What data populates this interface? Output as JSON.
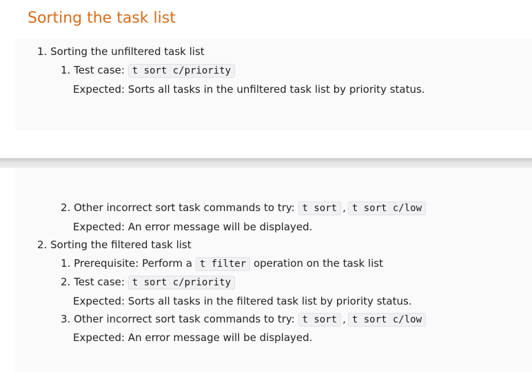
{
  "page": {
    "heading": "Sorting the task list",
    "section1": {
      "title": "1. Sorting the unfiltered task list",
      "step1": {
        "prefix": "1. Test case:",
        "code": "t sort c/priority",
        "expected": "Expected: Sorts all tasks in the unfiltered task list by priority status."
      },
      "step2": {
        "prefix": "2. Other incorrect sort task commands to try:",
        "code1": "t sort",
        "separator": ",",
        "code2": "t sort c/low",
        "expected": "Expected: An error message will be displayed."
      }
    },
    "section2": {
      "title": "2. Sorting the filtered task list",
      "step1": {
        "prefix": "1. Prerequisite: Perform a",
        "code": "t filter",
        "suffix": "operation on the task list"
      },
      "step2": {
        "prefix": "2. Test case:",
        "code": "t sort c/priority",
        "expected": "Expected: Sorts all tasks in the filtered task list by priority status."
      },
      "step3": {
        "prefix": "3. Other incorrect sort task commands to try:",
        "code1": "t sort",
        "separator": ",",
        "code2": "t sort c/low",
        "expected": "Expected: An error message will be displayed."
      }
    }
  }
}
